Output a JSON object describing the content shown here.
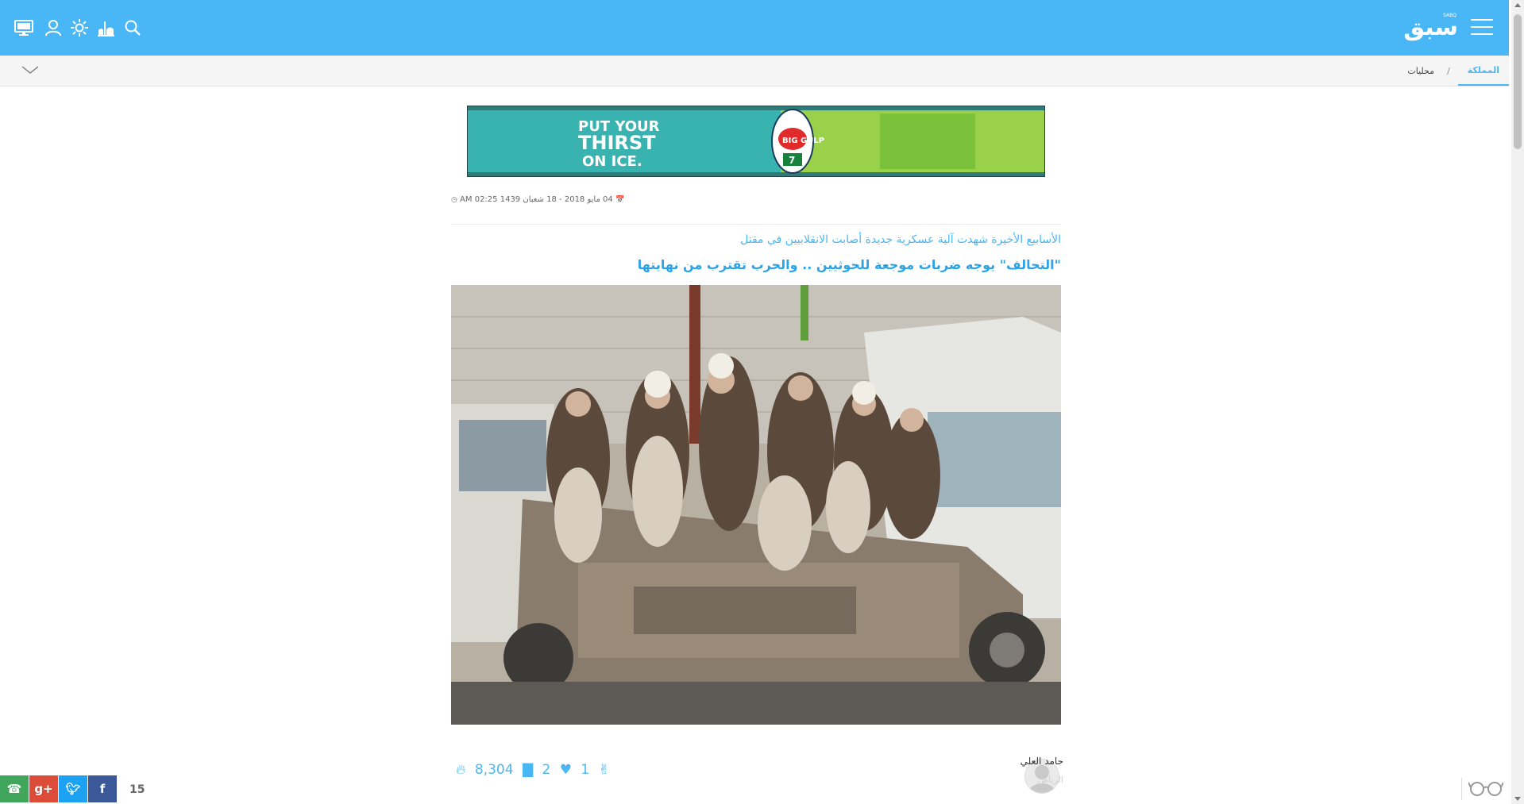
{
  "header": {
    "logo_text": "سبق",
    "logo_small": "SABQ",
    "icons": [
      "desktop-icon",
      "user-icon",
      "brightness-icon",
      "prayer-times-icon",
      "search-icon"
    ],
    "menu_icon": "hamburger-icon"
  },
  "breadcrumb": {
    "active": "المملكة",
    "separator": "/",
    "link": "محليات"
  },
  "ad": {
    "text_line1": "PUT YOUR",
    "text_line2": "THIRST",
    "text_line3": "ON ICE.",
    "brand": "BIG GULP",
    "sub_brand": "7"
  },
  "article": {
    "meta": "04 مايو 2018 - 18 شعبان 1439 02:25 AM",
    "subtitle": "الأسابيع الأخيرة شهدت آلية عسكرية جديدة أصابت الانقلابيين في مقتل",
    "headline": "\"التحالف\" يوجه ضربات موجعة للحوثيين .. والحرب تقترب من نهايتها",
    "author_name": "حامد العلي",
    "author_city": "الرياض",
    "stats": {
      "likes": "1",
      "comments": "2",
      "views": "8,304"
    }
  },
  "share": {
    "count": "15",
    "buttons": [
      "whatsapp-icon",
      "google-plus-icon",
      "twitter-icon",
      "facebook-icon"
    ]
  },
  "colors": {
    "brand": "#49b7f5",
    "whatsapp": "#40a65c",
    "google_plus": "#dd4b39",
    "twitter": "#1da1f2",
    "facebook": "#3b5998"
  }
}
